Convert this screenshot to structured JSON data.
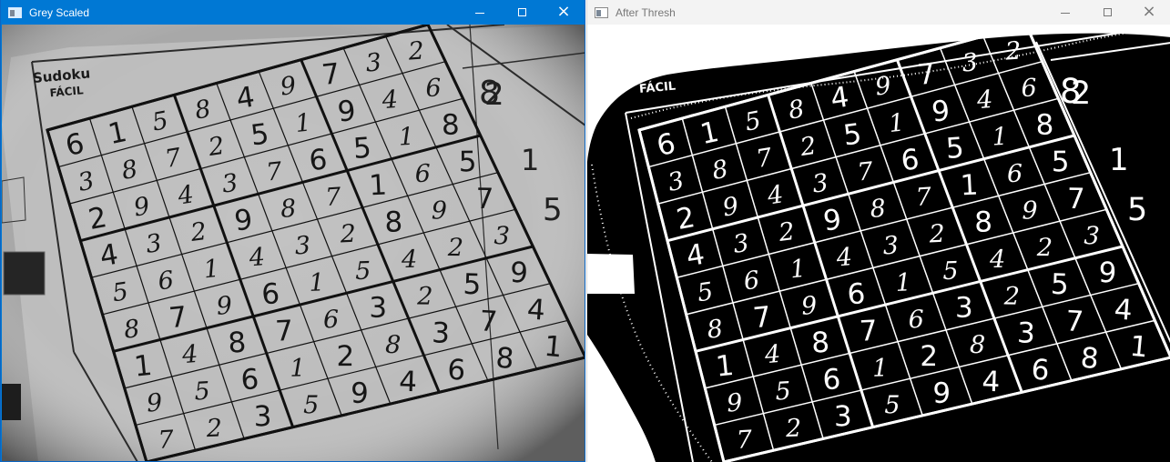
{
  "windows": [
    {
      "title": "Grey Scaled",
      "accent": "#0078d4",
      "controls": {
        "minimize_icon": "minimize-icon",
        "maximize_icon": "maximize-icon",
        "close_icon": "close-icon"
      },
      "image": {
        "kind": "grayscale-photo",
        "page_texts": [
          "Sudoku",
          "FÁCIL"
        ]
      }
    },
    {
      "title": "After Thresh",
      "accent": "#f3f3f3",
      "controls": {
        "minimize_icon": "minimize-icon",
        "maximize_icon": "maximize-icon",
        "close_icon": "close-icon"
      },
      "image": {
        "kind": "threshold-image"
      }
    }
  ],
  "sudoku": {
    "rows": [
      [
        "6",
        "1",
        "5",
        "8",
        "4",
        "9",
        "7",
        "3",
        "2"
      ],
      [
        "3",
        "8",
        "7",
        "2",
        "5",
        "1",
        "9",
        "4",
        "6"
      ],
      [
        "2",
        "9",
        "4",
        "3",
        "7",
        "6",
        "5",
        "1",
        "8"
      ],
      [
        "4",
        "3",
        "2",
        "9",
        "8",
        "7",
        "1",
        "6",
        "5"
      ],
      [
        "5",
        "6",
        "1",
        "4",
        "3",
        "2",
        "8",
        "9",
        "7"
      ],
      [
        "8",
        "7",
        "9",
        "6",
        "1",
        "5",
        "4",
        "2",
        "3"
      ],
      [
        "1",
        "4",
        "8",
        "7",
        "6",
        "3",
        "2",
        "5",
        "9"
      ],
      [
        "9",
        "5",
        "6",
        "1",
        "2",
        "8",
        "3",
        "7",
        "4"
      ],
      [
        "7",
        "2",
        "3",
        "5",
        "9",
        "4",
        "6",
        "8",
        "1"
      ]
    ],
    "edge_digits": [
      "8",
      "2",
      "1",
      "5"
    ]
  }
}
